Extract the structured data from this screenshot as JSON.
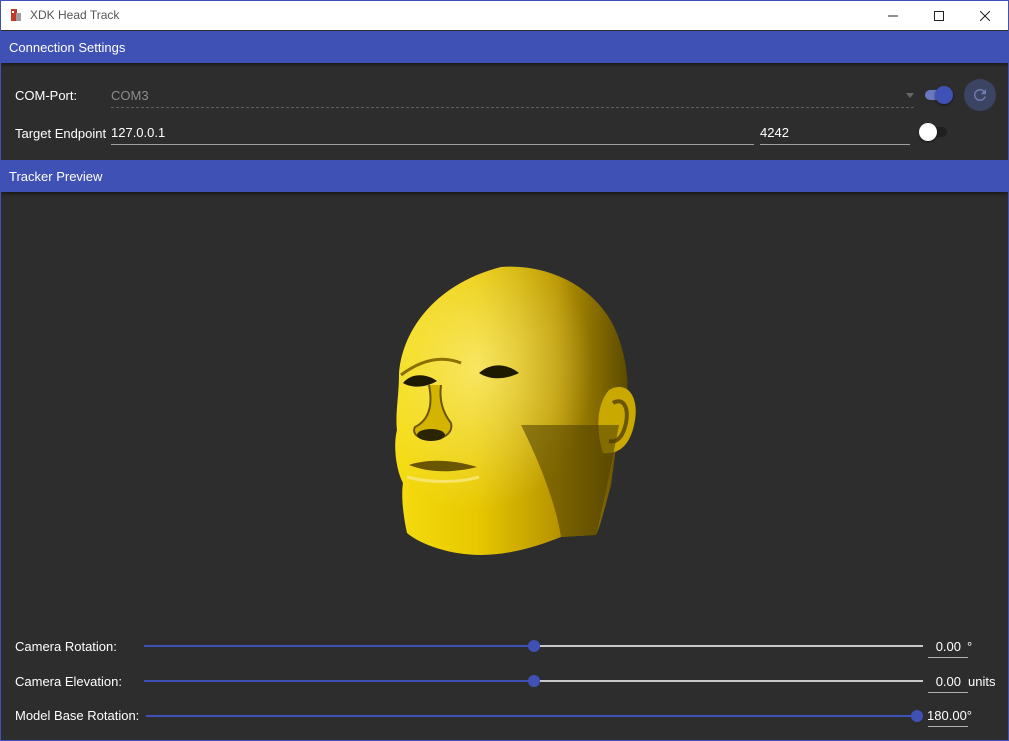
{
  "window": {
    "title": "XDK Head Track"
  },
  "connection": {
    "header": "Connection Settings",
    "com_port_label": "COM-Port:",
    "com_port_value": "COM3",
    "com_port_toggle": "on",
    "refresh_icon": "refresh-icon",
    "target_label": "Target Endpoint",
    "ip_value": "127.0.0.1",
    "port_value": "4242",
    "endpoint_toggle": "off"
  },
  "tracker": {
    "header": "Tracker Preview",
    "model": "yellow-head-model",
    "model_color": "#e6c400"
  },
  "sliders": [
    {
      "label": "Camera Rotation:",
      "value_text": "0.00",
      "unit": "°",
      "fraction": 0.5
    },
    {
      "label": "Camera Elevation:",
      "value_text": "0.00",
      "unit": "units",
      "fraction": 0.5
    },
    {
      "label": "Model Base Rotation:",
      "value_text": "180.00°",
      "unit": "",
      "fraction": 1.0
    }
  ],
  "colors": {
    "accent": "#3f51b5",
    "background": "#2d2d2d"
  }
}
